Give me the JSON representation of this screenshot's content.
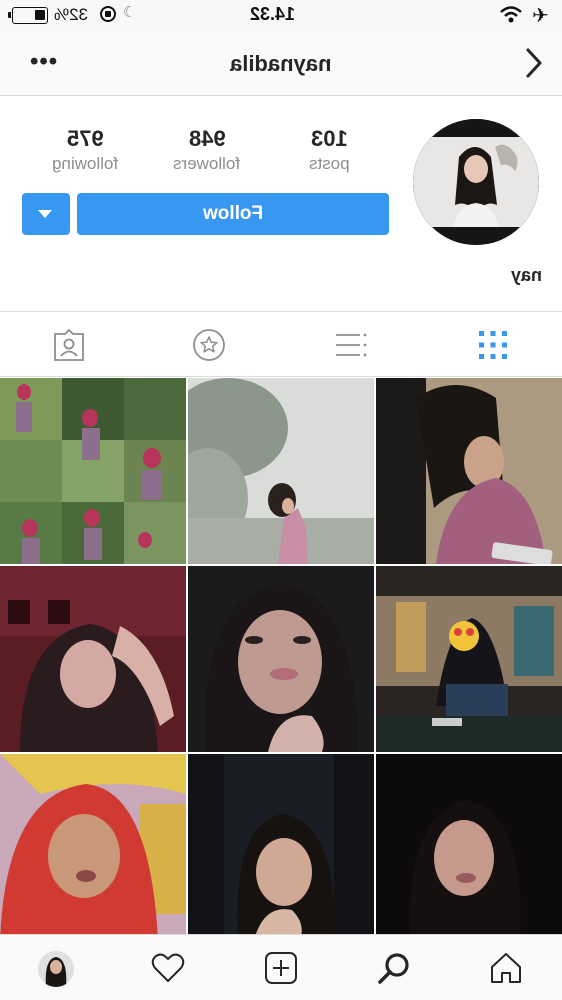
{
  "status_bar": {
    "battery_percent": "32%",
    "time": "14.32",
    "icons": [
      "battery-icon",
      "orientation-lock-icon",
      "moon-icon",
      "wifi-icon",
      "airplane-icon"
    ]
  },
  "header": {
    "username": "naynadila",
    "icons": [
      "more-icon",
      "back-chevron-icon"
    ]
  },
  "profile": {
    "display_name": "nay",
    "stats": [
      {
        "key": "posts",
        "value": "103",
        "label": "posts"
      },
      {
        "key": "followers",
        "value": "948",
        "label": "followers"
      },
      {
        "key": "following",
        "value": "975",
        "label": "following"
      }
    ],
    "follow_label": "Follow",
    "accent_color": "#3897f0"
  },
  "tabs": [
    {
      "name": "grid-view",
      "icon": "grid-icon",
      "active": true
    },
    {
      "name": "list-view",
      "icon": "list-icon",
      "active": false
    },
    {
      "name": "saved-view",
      "icon": "star-icon",
      "active": false
    },
    {
      "name": "tagged-view",
      "icon": "tagged-person-icon",
      "active": false
    }
  ],
  "posts_count_visible": 9,
  "bottom_nav": [
    {
      "name": "home",
      "icon": "home-icon"
    },
    {
      "name": "search",
      "icon": "search-icon"
    },
    {
      "name": "add",
      "icon": "add-post-icon"
    },
    {
      "name": "activity",
      "icon": "heart-icon"
    },
    {
      "name": "profile",
      "icon": "profile-avatar-icon"
    }
  ]
}
